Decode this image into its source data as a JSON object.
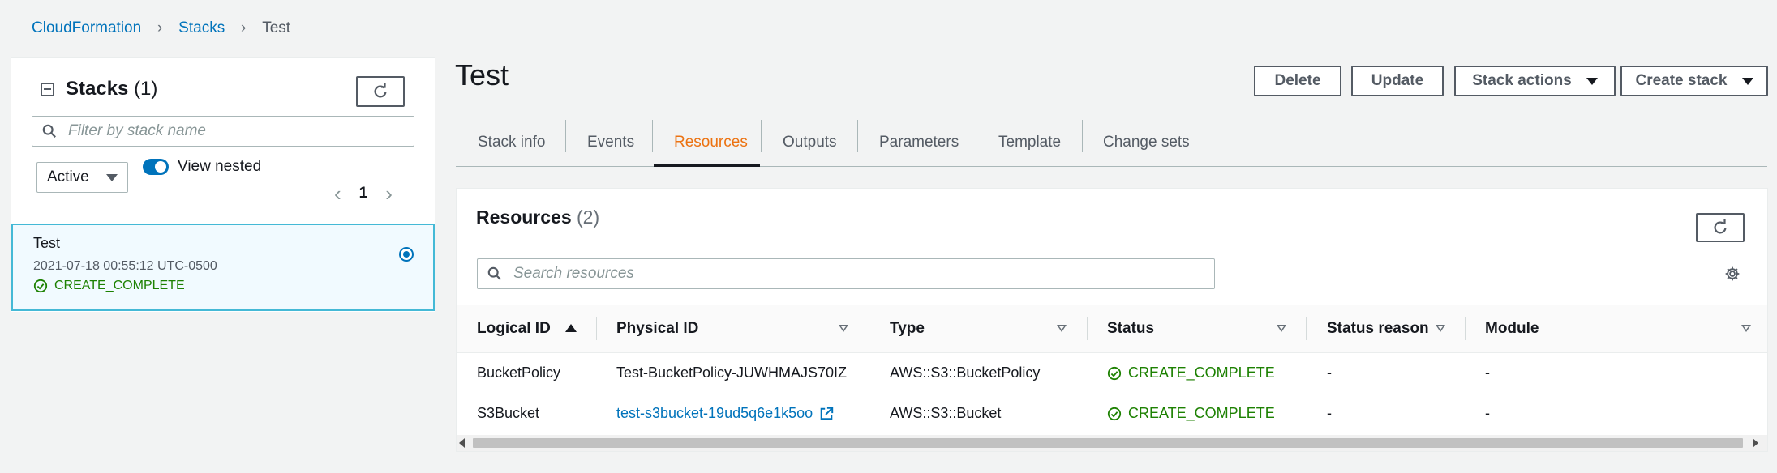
{
  "breadcrumb": {
    "root": "CloudFormation",
    "stacks": "Stacks",
    "current": "Test"
  },
  "stacks_panel": {
    "title": "Stacks",
    "count": "(1)",
    "filter_placeholder": "Filter by stack name",
    "status_filter": "Active",
    "view_nested_label": "View nested",
    "view_nested_on": true,
    "page": "1",
    "items": [
      {
        "name": "Test",
        "created": "2021-07-18 00:55:12 UTC-0500",
        "status": "CREATE_COMPLETE",
        "selected": true
      }
    ]
  },
  "header": {
    "title": "Test",
    "buttons": {
      "delete": "Delete",
      "update": "Update",
      "stack_actions": "Stack actions",
      "create_stack": "Create stack"
    }
  },
  "tabs": [
    {
      "label": "Stack info",
      "active": false
    },
    {
      "label": "Events",
      "active": false
    },
    {
      "label": "Resources",
      "active": true
    },
    {
      "label": "Outputs",
      "active": false
    },
    {
      "label": "Parameters",
      "active": false
    },
    {
      "label": "Template",
      "active": false
    },
    {
      "label": "Change sets",
      "active": false
    }
  ],
  "resources": {
    "title": "Resources",
    "count": "(2)",
    "search_placeholder": "Search resources",
    "columns": [
      "Logical ID",
      "Physical ID",
      "Type",
      "Status",
      "Status reason",
      "Module"
    ],
    "rows": [
      {
        "logical_id": "BucketPolicy",
        "physical_id": "Test-BucketPolicy-JUWHMAJS70IZ",
        "physical_is_link": false,
        "type": "AWS::S3::BucketPolicy",
        "status": "CREATE_COMPLETE",
        "status_reason": "-",
        "module": "-"
      },
      {
        "logical_id": "S3Bucket",
        "physical_id": "test-s3bucket-19ud5q6e1k5oo",
        "physical_is_link": true,
        "type": "AWS::S3::Bucket",
        "status": "CREATE_COMPLETE",
        "status_reason": "-",
        "module": "-"
      }
    ]
  },
  "colors": {
    "link": "#0073bb",
    "accent": "#ec7211",
    "success": "#1d8102",
    "selected_border": "#44b9d6"
  },
  "icons": [
    "refresh-icon",
    "search-icon",
    "settings-gear-icon",
    "external-link-icon",
    "check-circle-icon"
  ]
}
